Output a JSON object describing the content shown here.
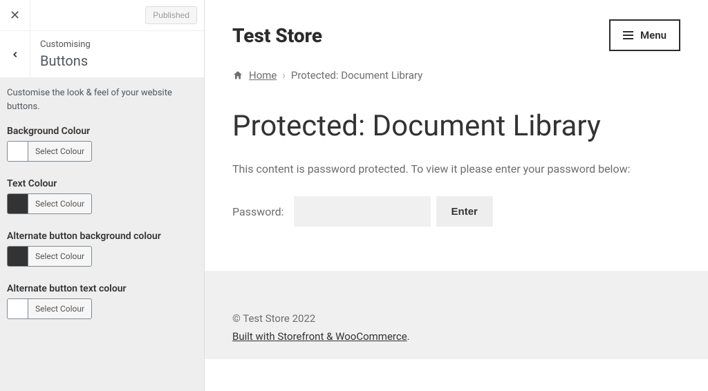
{
  "sidebar": {
    "publish_label": "Published",
    "customising_label": "Customising",
    "section_name": "Buttons",
    "description": "Customise the look & feel of your website buttons.",
    "select_colour_label": "Select Colour",
    "controls": [
      {
        "label": "Background Colour",
        "swatch": "#ffffff"
      },
      {
        "label": "Text Colour",
        "swatch": "#333333"
      },
      {
        "label": "Alternate button background colour",
        "swatch": "#333333"
      },
      {
        "label": "Alternate button text colour",
        "swatch": "#ffffff"
      }
    ]
  },
  "preview": {
    "store_title": "Test Store",
    "menu_label": "Menu",
    "breadcrumb_home": "Home",
    "breadcrumb_current": "Protected: Document Library",
    "page_title": "Protected: Document Library",
    "protected_message": "This content is password protected. To view it please enter your password below:",
    "password_label": "Password:",
    "enter_label": "Enter",
    "footer_copyright": "© Test Store 2022",
    "footer_credit": "Built with Storefront & WooCommerce",
    "footer_credit_suffix": "."
  }
}
